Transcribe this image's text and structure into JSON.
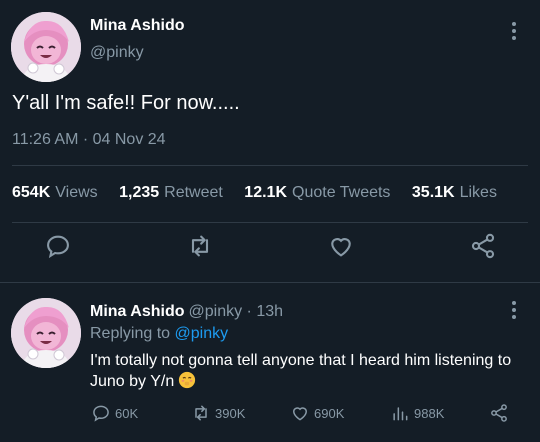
{
  "colors": {
    "background": "#141d26",
    "text": "#ffffff",
    "muted": "#8899a6",
    "link": "#1d9bf0",
    "divider": "#2f3a45"
  },
  "main_tweet": {
    "author_name": "Mina Ashido",
    "author_handle": "@pinky",
    "text": "Y'all I'm safe!! For now.....",
    "timestamp": "11:26 AM · 04 Nov 24",
    "stats": [
      {
        "value": "654K",
        "label": "Views"
      },
      {
        "value": "1,235",
        "label": "Retweet"
      },
      {
        "value": "12.1K",
        "label": "Quote Tweets"
      },
      {
        "value": "35.1K",
        "label": "Likes"
      }
    ],
    "actions": [
      "reply-icon",
      "retweet-icon",
      "like-icon",
      "share-icon"
    ]
  },
  "reply_tweet": {
    "author_name": "Mina Ashido",
    "handle_and_time": "@pinky · 13h",
    "replying_prefix": "Replying to",
    "replying_to": "@pinky",
    "text": "I'm totally not gonna tell anyone that I heard him listening to Juno by Y/n",
    "emoji": "blushing-giggle-emoji",
    "actions": [
      {
        "icon": "reply-icon",
        "count": "60K"
      },
      {
        "icon": "retweet-icon",
        "count": "390K"
      },
      {
        "icon": "like-icon",
        "count": "690K"
      },
      {
        "icon": "views-icon",
        "count": "988K"
      },
      {
        "icon": "share-icon",
        "count": ""
      }
    ]
  }
}
